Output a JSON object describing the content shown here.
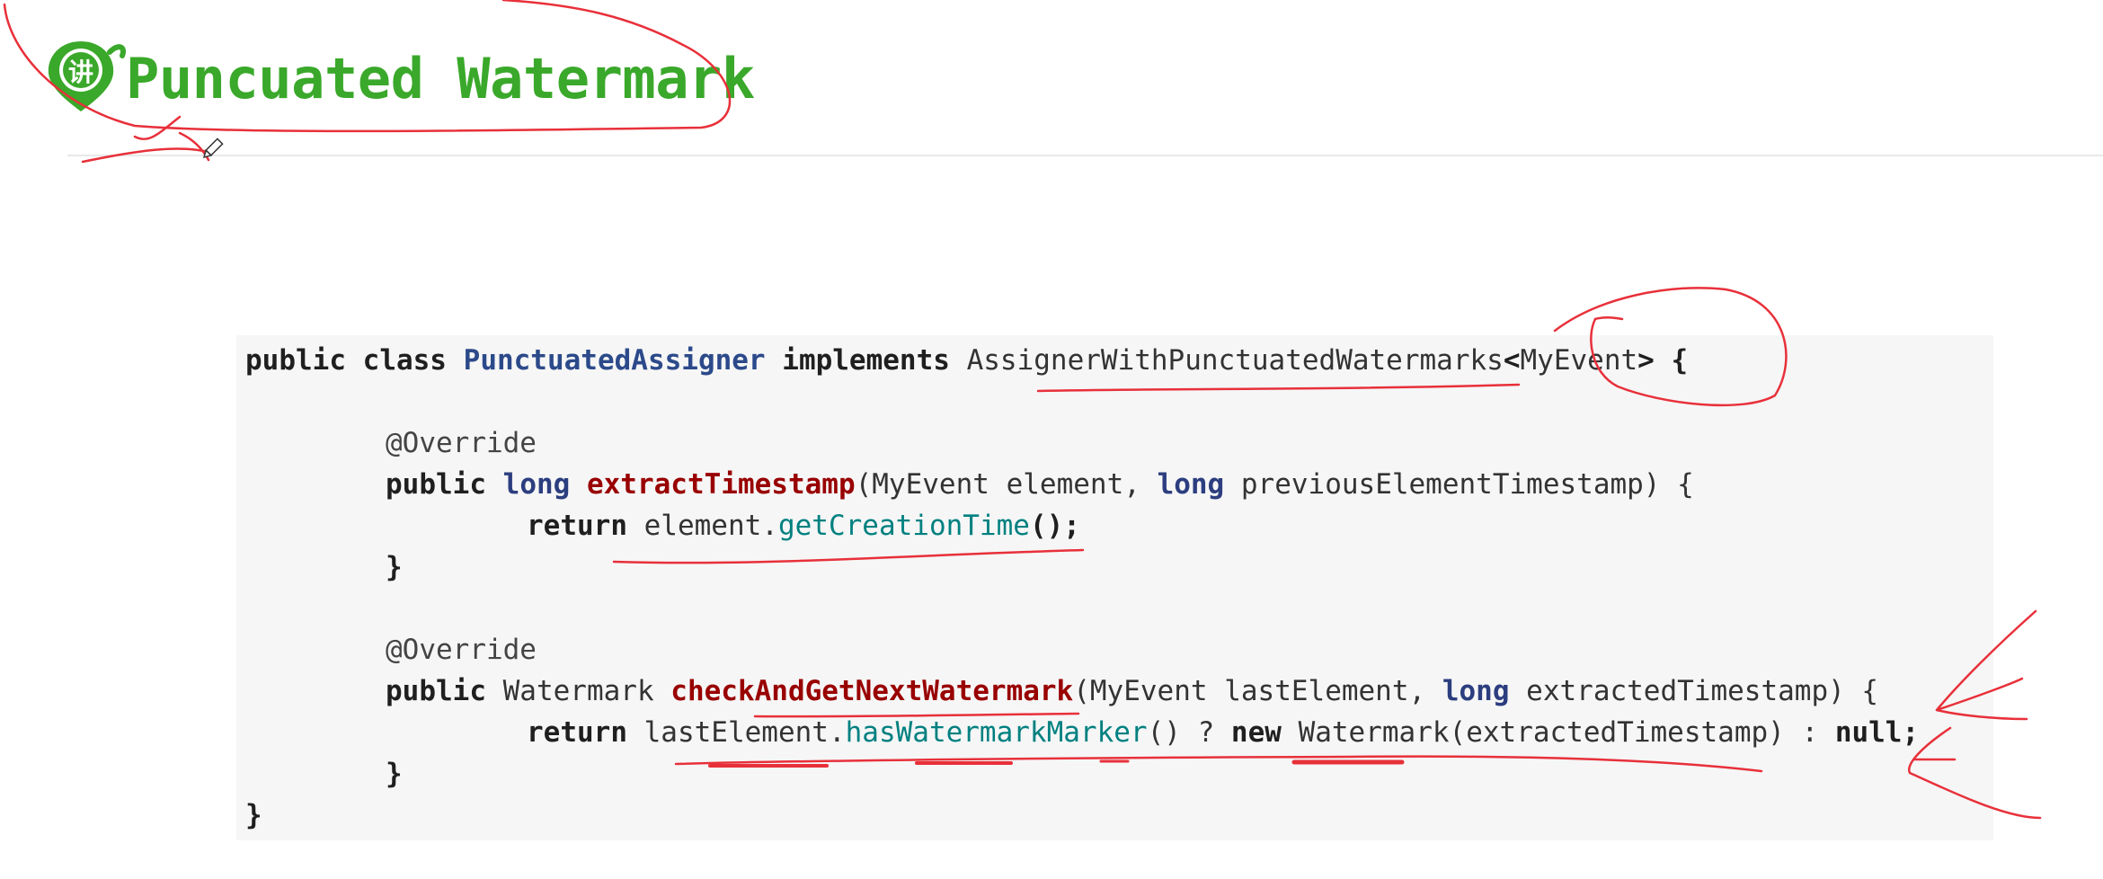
{
  "colors": {
    "heading_green": "#3aa82a",
    "pen_red": "#e8303a",
    "keyword_type_blue": "#2c3e7f",
    "method_name_red": "#990000",
    "method_call_teal": "#008080",
    "code_bg": "#f6f6f6"
  },
  "header": {
    "logo_icon": "map-pin-icon",
    "logo_glyph": "讲",
    "title": "Puncuated Watermark"
  },
  "code": {
    "line1": {
      "public": "public",
      "class": "class",
      "class_name": "PunctuatedAssigner",
      "implements": "implements",
      "interface": "AssignerWithPunctuatedWatermarks",
      "generic_open": "<",
      "generic_type": "MyEvent",
      "generic_close": ">",
      "brace": " {"
    },
    "line2": {
      "annotation": "@Override"
    },
    "line3": {
      "public": "public",
      "long": "long",
      "method": "extractTimestamp",
      "params_a": "(MyEvent element, ",
      "long2": "long",
      "params_b": " previousElementTimestamp) {"
    },
    "line4": {
      "return": "return",
      "target": " element.",
      "call": "getCreationTime",
      "end": "();"
    },
    "line5": {
      "brace": "}"
    },
    "line6": {
      "annotation": "@Override"
    },
    "line7": {
      "public": "public",
      "return_type": " Watermark ",
      "method": "checkAndGetNextWatermark",
      "params_a": "(MyEvent lastElement, ",
      "long": "long",
      "params_b": " extractedTimestamp) {"
    },
    "line8": {
      "return": "return",
      "target": " lastElement.",
      "call": "hasWatermarkMarker",
      "mid": "() ? ",
      "new": "new",
      "ctor": " Watermark(extractedTimestamp) : ",
      "null": "null",
      "end": ";"
    },
    "line9": {
      "brace": "}"
    },
    "line10": {
      "brace": "}"
    }
  }
}
